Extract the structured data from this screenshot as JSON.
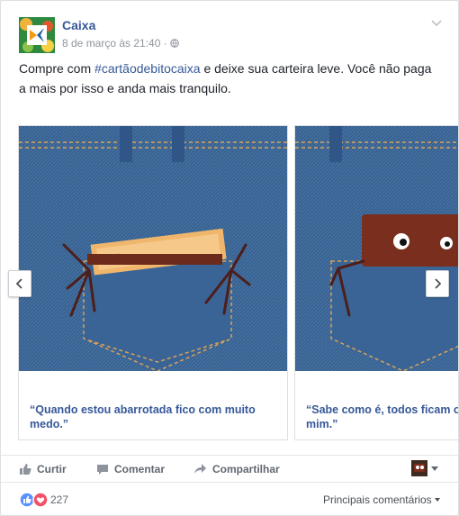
{
  "post": {
    "page_name": "Caixa",
    "timestamp": "8 de março às 21:40",
    "audience_icon": "globe-icon",
    "text_before": "Compre com ",
    "hashtag": "#cartãodebitocaixa",
    "text_after": " e deixe sua carteira leve. Você não paga a mais por isso e anda mais tranquilo."
  },
  "carousel": {
    "slides": [
      {
        "caption": "“Quando estou abarrotada fico com muito medo.”"
      },
      {
        "caption": "“Sabe como é, todos ficam olhando pra mim.”"
      }
    ],
    "prev_icon": "chevron-left-icon",
    "next_icon": "chevron-right-icon"
  },
  "actions": {
    "like_label": "Curtir",
    "comment_label": "Comentar",
    "share_label": "Compartilhar"
  },
  "reactions": {
    "count": "227",
    "sort_label": "Principais comentários"
  },
  "colors": {
    "link": "#365899",
    "denim": "#3a6594",
    "wallet": "#7a2e1e"
  }
}
